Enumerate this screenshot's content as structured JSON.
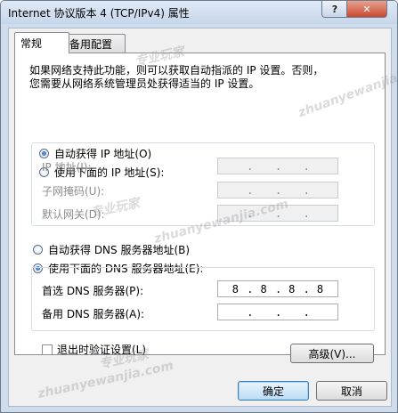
{
  "window": {
    "title": "Internet 协议版本 4 (TCP/IPv4) 属性",
    "help_label": "?",
    "close_label": "✕"
  },
  "tabs": [
    {
      "label": "常规",
      "selected": true
    },
    {
      "label": "备用配置",
      "selected": false
    }
  ],
  "description": {
    "line1": "如果网络支持此功能，则可以获取自动指派的 IP 设置。否则，",
    "line2": "您需要从网络系统管理员处获得适当的 IP 设置。"
  },
  "ip": {
    "auto_label": "自动获得 IP 地址(O)",
    "auto_selected": true,
    "manual_label": "使用下面的 IP 地址(S):",
    "fields": [
      {
        "label": "IP 地址(I):",
        "octets": [
          "",
          "",
          "",
          ""
        ]
      },
      {
        "label": "子网掩码(U):",
        "octets": [
          "",
          "",
          "",
          ""
        ]
      },
      {
        "label": "默认网关(D):",
        "octets": [
          "",
          "",
          "",
          ""
        ]
      }
    ]
  },
  "dns": {
    "auto_label": "自动获得 DNS 服务器地址(B)",
    "manual_label": "使用下面的 DNS 服务器地址(E):",
    "manual_selected": true,
    "fields": [
      {
        "label": "首选 DNS 服务器(P):",
        "octets": [
          "8",
          "8",
          "8",
          "8"
        ]
      },
      {
        "label": "备用 DNS 服务器(A):",
        "octets": [
          "",
          "",
          "",
          ""
        ]
      }
    ]
  },
  "validate_label": "退出时验证设置(L)",
  "buttons": {
    "advanced": "高级(V)...",
    "ok": "确定",
    "cancel": "取消"
  },
  "watermarks": {
    "brand_cn": "专业玩家",
    "brand_url": "zhuanyewanjia.com"
  }
}
